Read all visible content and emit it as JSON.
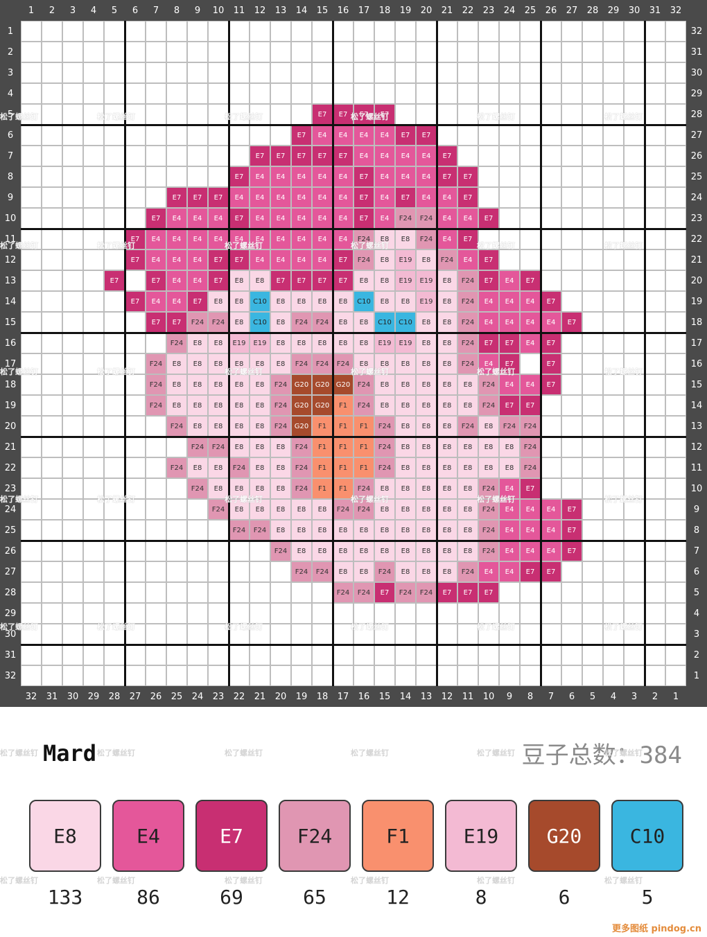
{
  "grid": {
    "size": 32,
    "top_numbers": [
      "1",
      "2",
      "3",
      "4",
      "5",
      "6",
      "7",
      "8",
      "9",
      "10",
      "11",
      "12",
      "13",
      "14",
      "15",
      "16",
      "17",
      "18",
      "19",
      "20",
      "21",
      "22",
      "23",
      "24",
      "25",
      "26",
      "27",
      "28",
      "29",
      "30",
      "31",
      "32"
    ],
    "bottom_numbers": [
      "32",
      "31",
      "30",
      "29",
      "28",
      "27",
      "26",
      "25",
      "24",
      "23",
      "22",
      "21",
      "20",
      "19",
      "18",
      "17",
      "16",
      "15",
      "14",
      "13",
      "12",
      "11",
      "10",
      "9",
      "8",
      "7",
      "6",
      "5",
      "4",
      "3",
      "2",
      "1"
    ],
    "left_numbers": [
      "1",
      "2",
      "3",
      "4",
      "5",
      "6",
      "7",
      "8",
      "9",
      "10",
      "11",
      "12",
      "13",
      "14",
      "15",
      "16",
      "17",
      "18",
      "19",
      "20",
      "21",
      "22",
      "23",
      "24",
      "25",
      "26",
      "27",
      "28",
      "29",
      "30",
      "31",
      "32"
    ],
    "right_numbers": [
      "32",
      "31",
      "30",
      "29",
      "28",
      "27",
      "26",
      "25",
      "24",
      "23",
      "22",
      "21",
      "20",
      "19",
      "18",
      "17",
      "16",
      "15",
      "14",
      "13",
      "12",
      "11",
      "10",
      "9",
      "8",
      "7",
      "6",
      "5",
      "4",
      "3",
      "2",
      "1"
    ],
    "rows": [
      "",
      "",
      "",
      "",
      "15:E7,E7,E7,E7",
      "14:E7,E4,E4,E4,E4,E7,E7",
      "12:E7,E7,E7,E7,E7,E4,E4,E4,E4,E7",
      "11:E7,E4,E4,E4,E4,E4,E7,E4,E4,E4,E7,E7",
      "8:E7,E7,E7,E4,E4,E4,E4,E4,E4,E7,E4,E7,E4,E4,E7",
      "7:E7,E4,E4,E4,E7,E4,E4,E4,E4,E4,E7,E4,F24,F24,E4,E4,E7",
      "6:E7,E4,E4,E4,E4,E4,E4,E4,E4,E4,E4,F24,E8,E8,F24,E4,E7",
      "6:E7,E4,E4,E4,E7,E7,E4,E4,E4,E4,E7,F24,E8,E19,E8,F24,E4,E7",
      "5:E7,,E7,E4,E4,E7,E8,E8,E7,E7,E7,E7,E8,E8,E19,E19,E8,F24,E7,E4,E7",
      "6:E7,E4,E4,E7,E8,E8,C10,E8,E8,E8,E8,C10,E8,E8,E19,E8,F24,E4,E4,E4,E7",
      "7:E7,E7,F24,F24,E8,C10,E8,F24,F24,E8,E8,C10,C10,E8,E8,F24,E4,E4,E4,E4,E7",
      "8:F24,E8,E8,E19,E19,E8,E8,E8,E8,E8,E19,E19,E8,E8,F24,E7,E7,E4,E7",
      "7:F24,E8,E8,E8,E8,E8,E8,F24,F24,F24,E8,E8,E8,E8,E8,F24,E4,E7,,E7",
      "7:F24,E8,E8,E8,E8,E8,F24,G20,G20,G20,F24,E8,E8,E8,E8,E8,F24,E4,E4,E7",
      "7:F24,E8,E8,E8,E8,E8,F24,G20,G20,F1,F24,E8,E8,E8,E8,E8,F24,E7,E7",
      "8:F24,E8,E8,E8,E8,F24,G20,F1,F1,F1,F24,E8,E8,E8,F24,E8,F24,F24",
      "9:F24,F24,E8,E8,E8,F24,F1,F1,F1,F24,E8,E8,E8,E8,E8,E8,F24",
      "8:F24,E8,E8,F24,E8,E8,F24,F1,F1,F1,F24,E8,E8,E8,E8,E8,E8,F24",
      "9:F24,E8,E8,E8,E8,F24,F1,F1,F24,E8,E8,E8,E8,E8,F24,E4,E7",
      "10:F24,E8,E8,E8,E8,E8,F24,F24,E8,E8,E8,E8,E8,F24,E4,E4,E4,E7",
      "11:F24,F24,E8,E8,E8,E8,E8,E8,E8,E8,E8,E8,F24,E4,E4,E4,E7",
      "13:F24,E8,E8,E8,E8,E8,E8,E8,E8,E8,F24,E4,E4,E4,E7",
      "14:F24,F24,E8,E8,F24,E8,E8,E8,F24,E4,E4,E7,E7",
      "16:F24,F24,E7,F24,F24,E7,E7,E7",
      "",
      "",
      "",
      ""
    ]
  },
  "colors": {
    "E8": {
      "fill": "#fad7e6",
      "text": "#333333"
    },
    "E4": {
      "fill": "#e4579a",
      "text": "#ffffff"
    },
    "E7": {
      "fill": "#c82f72",
      "text": "#ffffff"
    },
    "F24": {
      "fill": "#e096b2",
      "text": "#333333"
    },
    "F1": {
      "fill": "#f9906e",
      "text": "#333333"
    },
    "E19": {
      "fill": "#f3bad3",
      "text": "#333333"
    },
    "G20": {
      "fill": "#a64a2c",
      "text": "#ffffff"
    },
    "C10": {
      "fill": "#3ab6e0",
      "text": "#222222"
    }
  },
  "watermark_text": "松了螺丝钉",
  "brand": "Mard",
  "total_label": "豆子总数：384",
  "palette": [
    {
      "code": "E8",
      "count": "133",
      "fill": "#fad7e6",
      "text": "#222222"
    },
    {
      "code": "E4",
      "count": "86",
      "fill": "#e4579a",
      "text": "#222222"
    },
    {
      "code": "E7",
      "count": "69",
      "fill": "#c82f72",
      "text": "#ffffff"
    },
    {
      "code": "F24",
      "count": "65",
      "fill": "#e096b2",
      "text": "#222222"
    },
    {
      "code": "F1",
      "count": "12",
      "fill": "#f9906e",
      "text": "#222222"
    },
    {
      "code": "E19",
      "count": "8",
      "fill": "#f3bad3",
      "text": "#222222"
    },
    {
      "code": "G20",
      "count": "6",
      "fill": "#a64a2c",
      "text": "#ffffff"
    },
    {
      "code": "C10",
      "count": "5",
      "fill": "#3ab6e0",
      "text": "#222222"
    }
  ],
  "footer_brand": "更多图纸 pindog.cn"
}
